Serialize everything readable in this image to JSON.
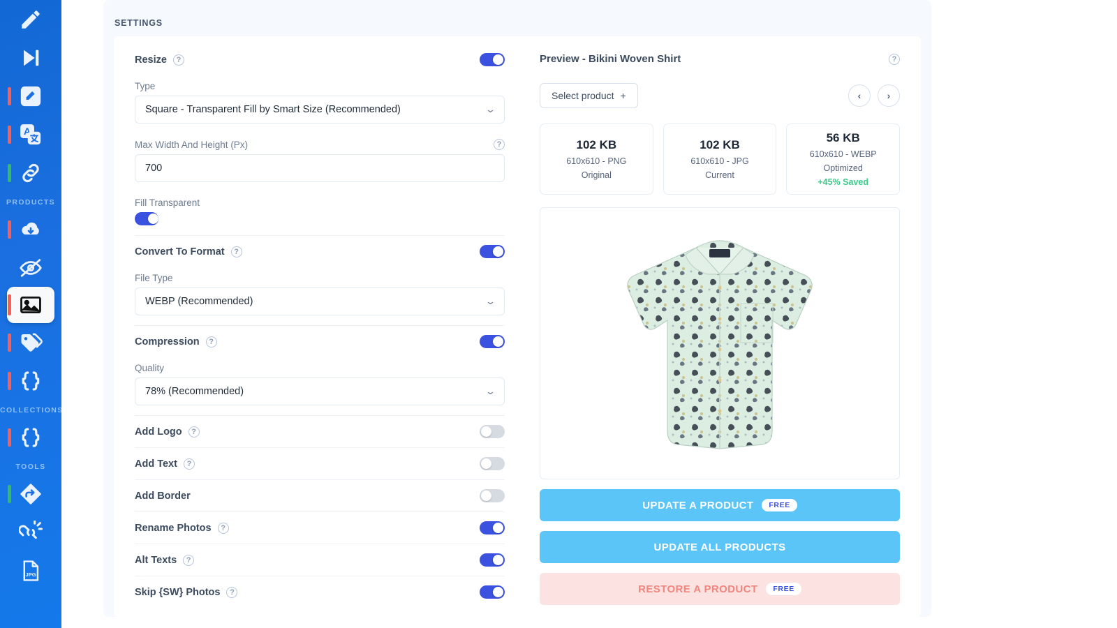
{
  "sidebar": {
    "items": [
      {
        "icon": "pencil-icon",
        "accent": null,
        "section": null,
        "active": false
      },
      {
        "icon": "skip-forward-icon",
        "accent": null,
        "section": null,
        "active": false
      },
      {
        "icon": "edit-square-icon",
        "accent": "#f4615a",
        "section": null,
        "active": false
      },
      {
        "icon": "translate-icon",
        "accent": "#f4615a",
        "section": null,
        "active": false
      },
      {
        "icon": "link-chain-icon",
        "accent": "#35b96a",
        "section": null,
        "active": false
      },
      {
        "icon": "cloud-download-icon",
        "accent": "#f4615a",
        "section": "PRODUCTS",
        "active": false
      },
      {
        "icon": "eye-off-icon",
        "accent": null,
        "section": null,
        "active": false
      },
      {
        "icon": "image-icon",
        "accent": "#f4615a",
        "section": null,
        "active": true
      },
      {
        "icon": "tags-icon",
        "accent": "#f4615a",
        "section": null,
        "active": false
      },
      {
        "icon": "braces-icon",
        "accent": "#f4615a",
        "section": null,
        "active": false
      },
      {
        "icon": "braces-icon",
        "accent": "#f4615a",
        "section": "COLLECTIONS",
        "active": false
      },
      {
        "icon": "redirect-icon",
        "accent": "#35b96a",
        "section": "TOOLS",
        "active": false
      },
      {
        "icon": "broken-link-icon",
        "accent": null,
        "section": null,
        "active": false
      },
      {
        "icon": "jpg-file-icon",
        "accent": null,
        "section": null,
        "active": false
      }
    ],
    "sections": {
      "products": "PRODUCTS",
      "collections": "COLLECTIONS",
      "tools": "TOOLS"
    }
  },
  "panel": {
    "title": "SETTINGS"
  },
  "settings": {
    "resize": {
      "label": "Resize",
      "toggle": "on",
      "type_label": "Type",
      "type_value": "Square - Transparent Fill by Smart Size (Recommended)",
      "maxwh_label": "Max Width And Height (Px)",
      "maxwh_value": "700",
      "fill_label": "Fill Transparent",
      "fill_toggle": "on"
    },
    "convert": {
      "label": "Convert To Format",
      "toggle": "on",
      "filetype_label": "File Type",
      "filetype_value": "WEBP (Recommended)"
    },
    "compression": {
      "label": "Compression",
      "toggle": "on",
      "quality_label": "Quality",
      "quality_value": "78% (Recommended)"
    },
    "simple_rows": [
      {
        "label": "Add Logo",
        "toggle": "off",
        "help": true
      },
      {
        "label": "Add Text",
        "toggle": "off",
        "help": true
      },
      {
        "label": "Add Border",
        "toggle": "off",
        "help": false
      },
      {
        "label": "Rename Photos",
        "toggle": "on",
        "help": true
      },
      {
        "label": "Alt Texts",
        "toggle": "on",
        "help": true
      },
      {
        "label": "Skip {SW} Photos",
        "toggle": "on",
        "help": true
      }
    ],
    "help_glyph": "?"
  },
  "preview": {
    "title": "Preview - Bikini Woven Shirt",
    "select_product_label": "Select product",
    "select_product_plus": "+",
    "prev_glyph": "‹",
    "next_glyph": "›",
    "stats": [
      {
        "size": "102 KB",
        "dimensions": "610x610 - PNG",
        "tag": "Original",
        "saved": ""
      },
      {
        "size": "102 KB",
        "dimensions": "610x610 - JPG",
        "tag": "Current",
        "saved": ""
      },
      {
        "size": "56 KB",
        "dimensions": "610x610 - WEBP",
        "tag": "Optimized",
        "saved": "+45% Saved"
      }
    ],
    "product_image_alt": "Bikini Woven Shirt - mint green patterned short sleeve button shirt",
    "actions": [
      {
        "label": "UPDATE A PRODUCT",
        "badge": "FREE",
        "style": "primary"
      },
      {
        "label": "UPDATE ALL PRODUCTS",
        "badge": "",
        "style": "primary"
      },
      {
        "label": "RESTORE A PRODUCT",
        "badge": "FREE",
        "style": "danger"
      }
    ]
  },
  "colors": {
    "sidebar_blue": "#1b6fe0",
    "toggle_on": "#3b52e0",
    "accent_red": "#f4615a",
    "accent_green": "#35b96a",
    "action_blue": "#5bc5f7",
    "danger_bg": "#fce3e1",
    "danger_text": "#f2857e",
    "saved_green": "#3cc98a",
    "panel_bg": "#f6f9fd"
  }
}
